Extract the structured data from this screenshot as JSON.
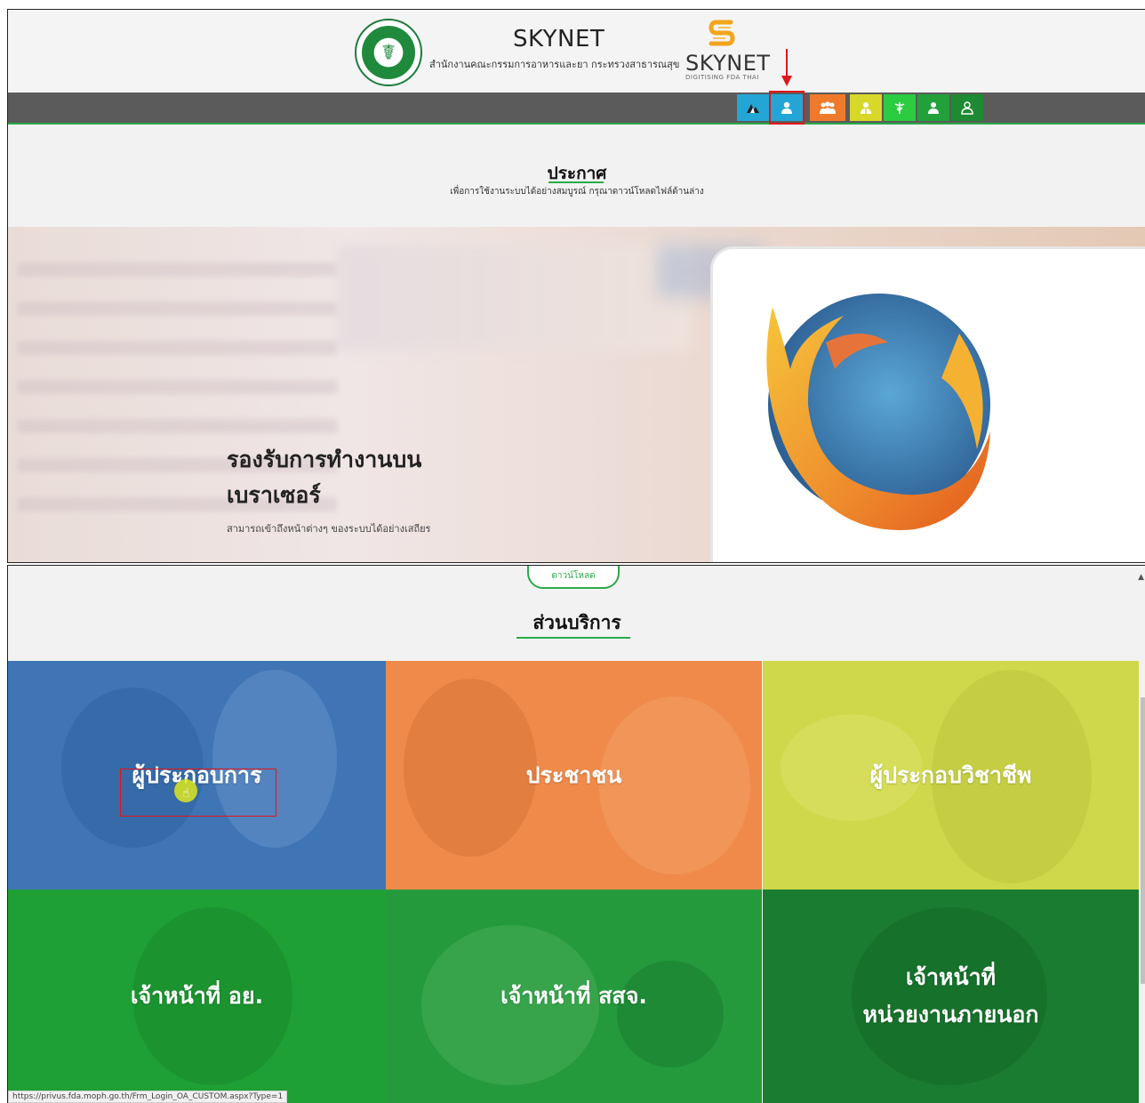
{
  "header": {
    "title": "SKYNET",
    "subtitle": "สำนักงานคณะกรรมการอาหารและยา กระทรวงสาธารณสุข",
    "logo_text": "SKYNET",
    "logo_tagline": "DIGITISING FDA THAI"
  },
  "nav": {
    "buttons": [
      {
        "icon": "mountain-icon",
        "color": "#23a6d5"
      },
      {
        "icon": "user-icon",
        "color": "#23a6d5",
        "highlighted": true
      },
      {
        "icon": "group-icon",
        "color": "#ef7a2b"
      },
      {
        "icon": "professional-icon",
        "color": "#d8d82a"
      },
      {
        "icon": "caduceus-icon",
        "color": "#2bcc3f"
      },
      {
        "icon": "officer-icon",
        "color": "#22a03a"
      },
      {
        "icon": "staff-icon",
        "color": "#1e8a34"
      }
    ]
  },
  "announcement": {
    "title": "ประกาศ",
    "description": "เพื่อการใช้งานระบบได้อย่างสมบูรณ์ กรุณาดาวน์โหลดไฟล์ด้านล่าง"
  },
  "hero": {
    "heading_line1": "รองรับการทำงานบน",
    "heading_line2": "เบราเซอร์",
    "subtext": "สามารถเข้าถึงหน้าต่างๆ ของระบบได้อย่างเสถียร"
  },
  "download": {
    "label": "ดาวน์โหลด"
  },
  "services": {
    "title": "ส่วนบริการ",
    "tiles": {
      "entrepreneur": "ผู้ประกอบการ",
      "public": "ประชาชน",
      "professional": "ผู้ประกอบวิชาชีพ",
      "fda_staff": "เจ้าหน้าที่ อย.",
      "provincial_staff": "เจ้าหน้าที่ สสจ.",
      "external_staff_line1": "เจ้าหน้าที่",
      "external_staff_line2": "หน่วยงานภายนอก"
    }
  },
  "status_bar": {
    "url": "https://privus.fda.moph.go.th/Frm_Login_OA_CUSTOM.aspx?Type=1"
  }
}
